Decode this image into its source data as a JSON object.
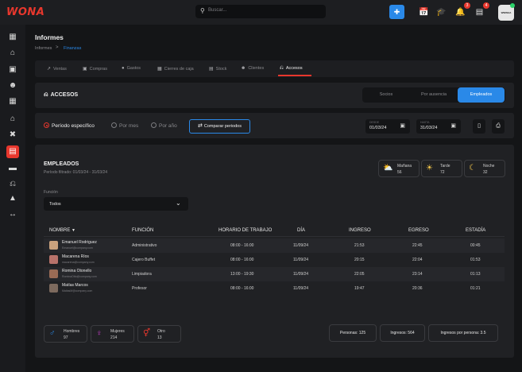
{
  "app": {
    "logo": "WONA"
  },
  "topbar": {
    "search_placeholder": "Buscar...",
    "notifications_badge": "3",
    "messages_badge": "4",
    "avatar_text": "WWWHA"
  },
  "header": {
    "title": "Informes",
    "breadcrumb": [
      "Informes",
      "Finanzas"
    ],
    "breadcrumb_separator": ">"
  },
  "tabs": [
    {
      "label": "Ventas",
      "icon": "chart-icon"
    },
    {
      "label": "Compras",
      "icon": "cart-icon"
    },
    {
      "label": "Gastos",
      "icon": "money-icon"
    },
    {
      "label": "Cierres de caja",
      "icon": "register-icon"
    },
    {
      "label": "Stock",
      "icon": "box-icon"
    },
    {
      "label": "Clientes",
      "icon": "users-icon"
    },
    {
      "label": "Accesos",
      "icon": "turnstile-icon",
      "active": true
    }
  ],
  "accesos": {
    "title": "ACCESOS",
    "segments": [
      "Socios",
      "Por ausencia",
      "Empleados"
    ],
    "active_segment": "Empleados"
  },
  "filters": {
    "options": [
      "Período específico",
      "Por mes",
      "Por año"
    ],
    "selected": "Período específico",
    "compare_label": "Comparar periodos",
    "desde_label": "DESDE",
    "desde_value": "01/03/24",
    "hasta_label": "HASTA",
    "hasta_value": "31/03/24"
  },
  "empleados": {
    "title": "EMPLEADOS",
    "subtitle": "Período filtrado: 01/03/24 - 31/03/24",
    "shifts": [
      {
        "label": "Mañana",
        "value": "56",
        "icon": "sun-cloud-icon"
      },
      {
        "label": "Tarde",
        "value": "72",
        "icon": "sun-icon"
      },
      {
        "label": "Noche",
        "value": "32",
        "icon": "moon-icon"
      }
    ],
    "funcion_label": "Función",
    "funcion_value": "Todos"
  },
  "table": {
    "headers": [
      "NOMBRE",
      "FUNCIÓN",
      "HORARIO DE TRABAJO",
      "DÍA",
      "INGRESO",
      "EGRESO",
      "ESTADÍA"
    ],
    "rows": [
      {
        "name": "Emanuel Rodriguez",
        "email": "Emanuel@company.com",
        "funcion": "Administrativo",
        "horario": "08:00 - 16:00",
        "dia": "11/09/24",
        "ingreso": "21:53",
        "egreso": "22:45",
        "estadia": "00:45"
      },
      {
        "name": "Macarena Ríos",
        "email": "macarena@company.com",
        "funcion": "Cajero Buffet",
        "horario": "08:00 - 16:00",
        "dia": "11/09/24",
        "ingreso": "20:15",
        "egreso": "22:04",
        "estadia": "01:53"
      },
      {
        "name": "Romina Otonello",
        "email": "RominaOtto@company.com",
        "funcion": "Limpiadora",
        "horario": "13:00 - 19:30",
        "dia": "11/09/24",
        "ingreso": "22:05",
        "egreso": "23:14",
        "estadia": "01:13"
      },
      {
        "name": "Matías Marcos",
        "email": "MatiasM@company.com",
        "funcion": "Profesor",
        "horario": "08:00 - 16:00",
        "dia": "11/09/24",
        "ingreso": "19:47",
        "egreso": "20:36",
        "estadia": "01:21"
      }
    ]
  },
  "gender": [
    {
      "label": "Hombres",
      "value": "97",
      "icon": "male-icon",
      "color": "#2a89e8"
    },
    {
      "label": "Mujeres",
      "value": "214",
      "icon": "female-icon",
      "color": "#d43fd6"
    },
    {
      "label": "Otro",
      "value": "13",
      "icon": "other-gender-icon",
      "color": "#e8372d"
    }
  ],
  "stats": {
    "personas": "Personas: 125",
    "ingresos": "Ingresos: 564",
    "ingresos_por_persona": "Ingresos por persona: 3.5"
  },
  "colors": {
    "accent": "#2a89e8",
    "brand": "#e8372d",
    "background": "#141517"
  }
}
